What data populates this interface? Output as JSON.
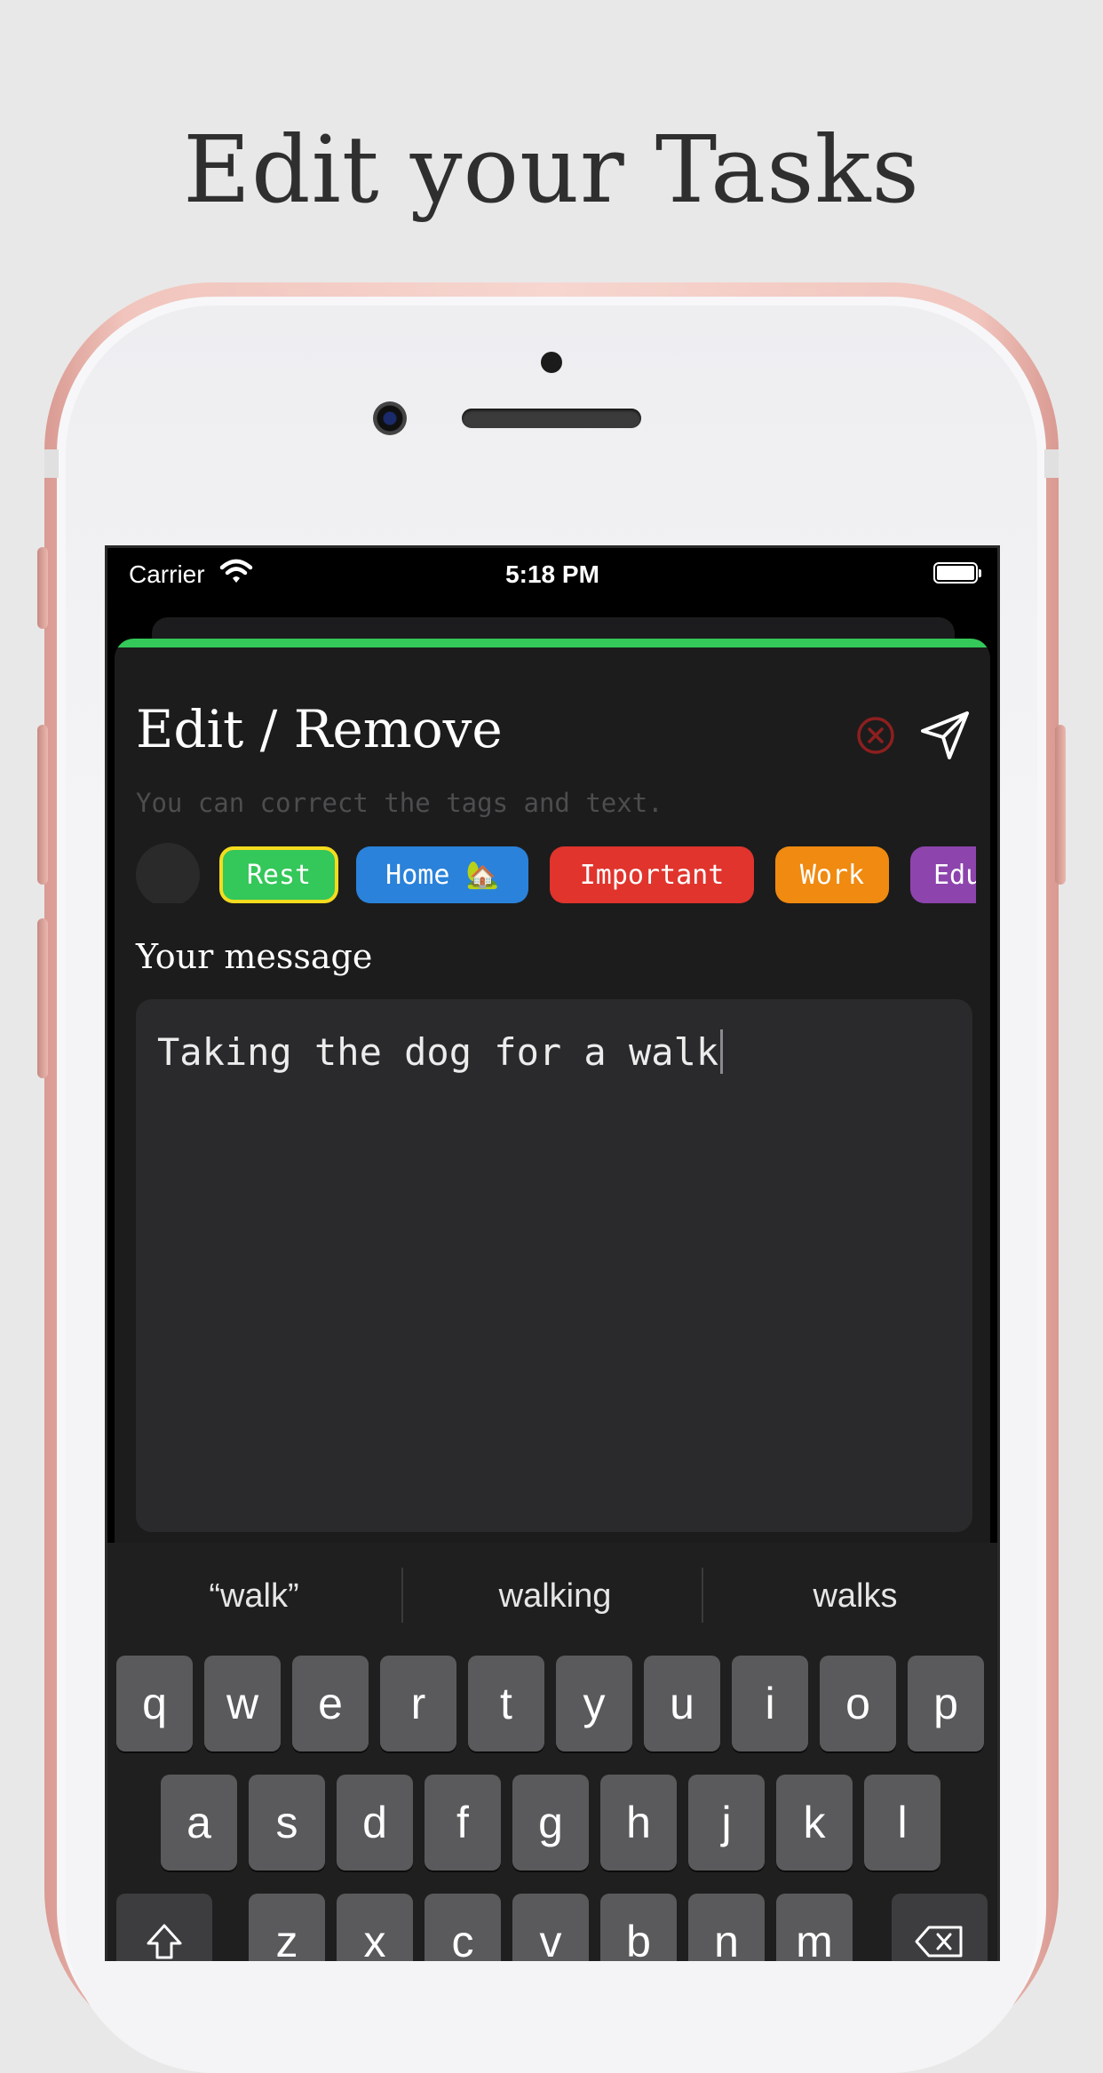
{
  "headline": "Edit your Tasks",
  "status_bar": {
    "carrier": "Carrier",
    "time": "5:18 PM"
  },
  "sheet": {
    "accent_color": "#34c759",
    "title": "Edit / Remove",
    "subtitle": "You can correct the tags and text.",
    "tags": [
      {
        "label": "Rest",
        "color": "#34c759",
        "selected": true
      },
      {
        "label": "Home 🏡",
        "color": "#2a82da",
        "selected": false
      },
      {
        "label": "Important",
        "color": "#e0342d",
        "selected": false
      },
      {
        "label": "Work",
        "color": "#f08a10",
        "selected": false
      },
      {
        "label": "Edu",
        "color": "#8e44ad",
        "selected": false
      }
    ],
    "message_label": "Your message",
    "message_value": "Taking the dog for a walk"
  },
  "keyboard": {
    "predictions": [
      "“walk”",
      "walking",
      "walks"
    ],
    "row1": [
      "q",
      "w",
      "e",
      "r",
      "t",
      "y",
      "u",
      "i",
      "o",
      "p"
    ],
    "row2": [
      "a",
      "s",
      "d",
      "f",
      "g",
      "h",
      "j",
      "k",
      "l"
    ],
    "row3": [
      "z",
      "x",
      "c",
      "v",
      "b",
      "n",
      "m"
    ]
  }
}
